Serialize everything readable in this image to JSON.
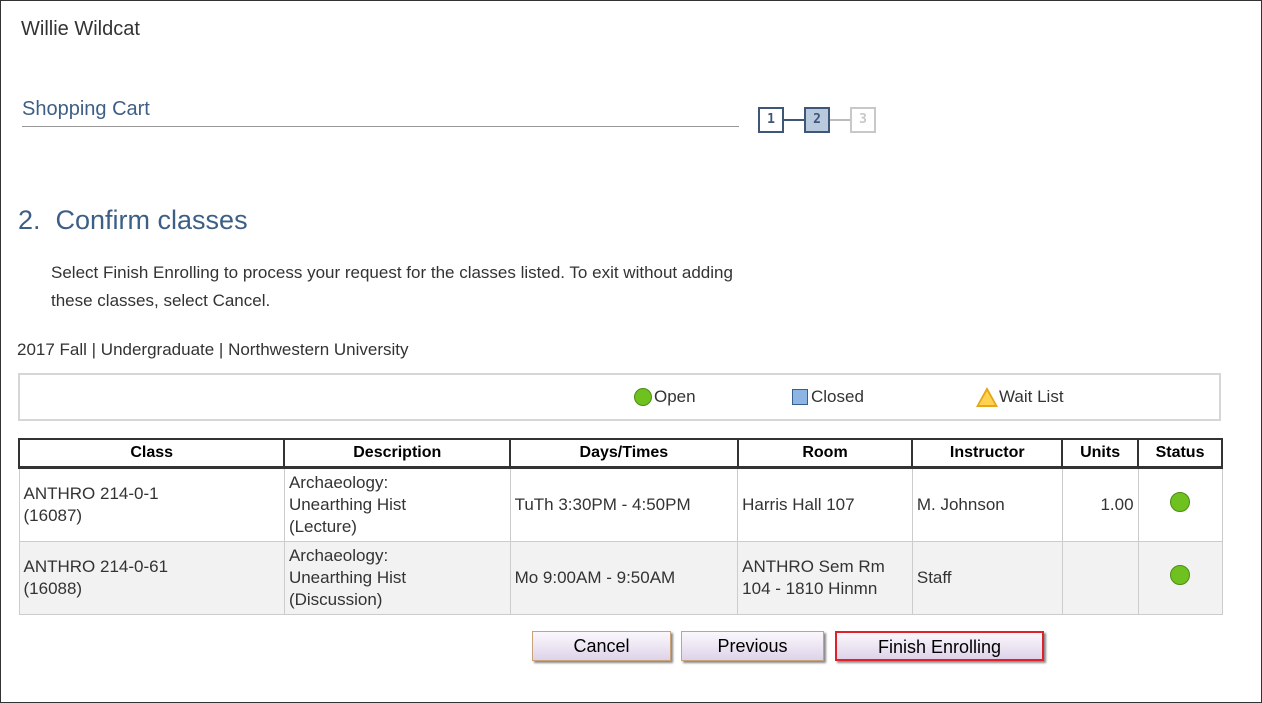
{
  "user": {
    "name": "Willie Wildcat"
  },
  "section": {
    "title": "Shopping Cart"
  },
  "steps": [
    "1",
    "2",
    "3"
  ],
  "page": {
    "heading": "2.  Confirm classes",
    "instructions": "Select Finish Enrolling to process your request for the classes listed. To exit without adding these classes, select Cancel.",
    "term": "2017 Fall | Undergraduate | Northwestern University"
  },
  "legend": {
    "open": "Open",
    "closed": "Closed",
    "wait_list": "Wait List"
  },
  "table": {
    "headers": [
      "Class",
      "Description",
      "Days/Times",
      "Room",
      "Instructor",
      "Units",
      "Status"
    ],
    "rows": [
      {
        "class_name": "ANTHRO 214-0-1",
        "class_id": "(16087)",
        "desc1": "Archaeology:",
        "desc2": "Unearthing Hist",
        "desc3": "(Lecture)",
        "days_times": "TuTh 3:30PM - 4:50PM",
        "room1": "Harris Hall 107",
        "room2": "",
        "instructor": "M. Johnson",
        "units": "1.00",
        "status": "open"
      },
      {
        "class_name": "ANTHRO 214-0-61",
        "class_id": "(16088)",
        "desc1": "Archaeology:",
        "desc2": "Unearthing Hist",
        "desc3": "(Discussion)",
        "days_times": "Mo 9:00AM - 9:50AM",
        "room1": "ANTHRO Sem Rm",
        "room2": "104 - 1810 Hinmn",
        "instructor": "Staff",
        "units": "",
        "status": "open"
      }
    ]
  },
  "buttons": {
    "cancel": "Cancel",
    "previous": "Previous",
    "finish": "Finish Enrolling"
  },
  "colors": {
    "heading": "#3e5f85",
    "open": "#6fc11f",
    "closed": "#8db5e3",
    "wait": "#e4a61a",
    "finish_border": "#e0202a"
  }
}
